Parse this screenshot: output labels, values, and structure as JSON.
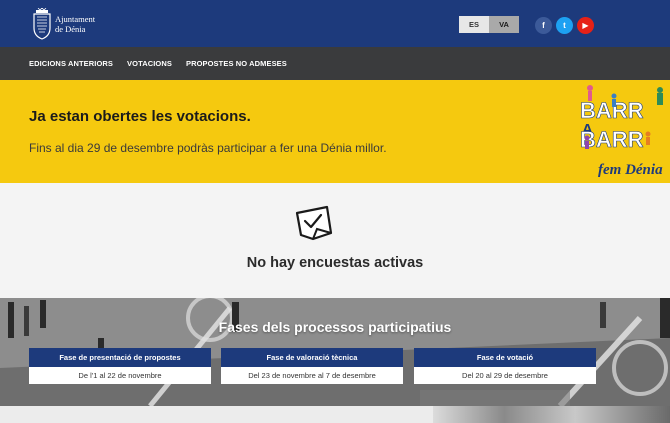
{
  "header": {
    "org_line1": "Ajuntament",
    "org_line2": "de Dénia",
    "lang_es": "ES",
    "lang_va": "VA",
    "social": {
      "facebook": "f",
      "twitter": "t",
      "youtube": "▶"
    }
  },
  "nav": {
    "items": [
      "EDICIONS ANTERIORS",
      "VOTACIONS",
      "PROPOSTES NO ADMESES"
    ]
  },
  "banner": {
    "title": "Ja estan obertes les votacions.",
    "subtitle": "Fins al dia 29 de desembre podràs participar a fer una Dénia millor.",
    "logo_lines": [
      "BARR",
      "A",
      "BARR",
      "fem Dénia"
    ]
  },
  "empty": {
    "message": "No hay encuestas activas"
  },
  "phases": {
    "title": "Fases dels processos participatius",
    "cards": [
      {
        "title": "Fase de presentació de propostes",
        "dates": "De l'1 al 22 de novembre"
      },
      {
        "title": "Fase de valoració tècnica",
        "dates": "Del 23 de novembre al 7 de desembre"
      },
      {
        "title": "Fase de votació",
        "dates": "Del 20 al 29 de desembre"
      }
    ]
  },
  "colors": {
    "header_blue": "#1d3a7c",
    "nav_gray": "#3a3b3d",
    "banner_yellow": "#f5c90f"
  }
}
